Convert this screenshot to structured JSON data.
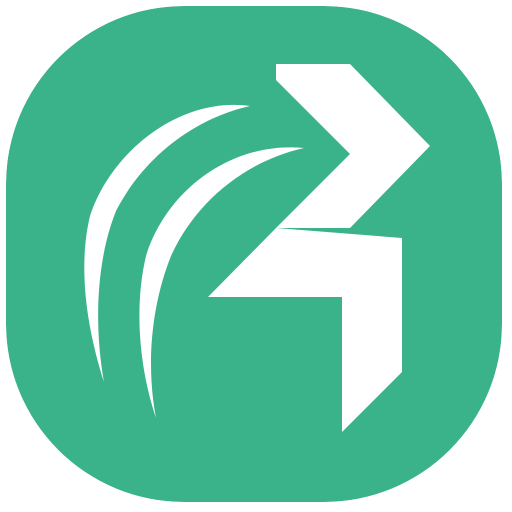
{
  "icon": {
    "name": "app-icon",
    "glyph": "swoosh-arrow-icon",
    "colors": {
      "background": "#3BB38A",
      "glyph": "#FFFFFF"
    }
  }
}
